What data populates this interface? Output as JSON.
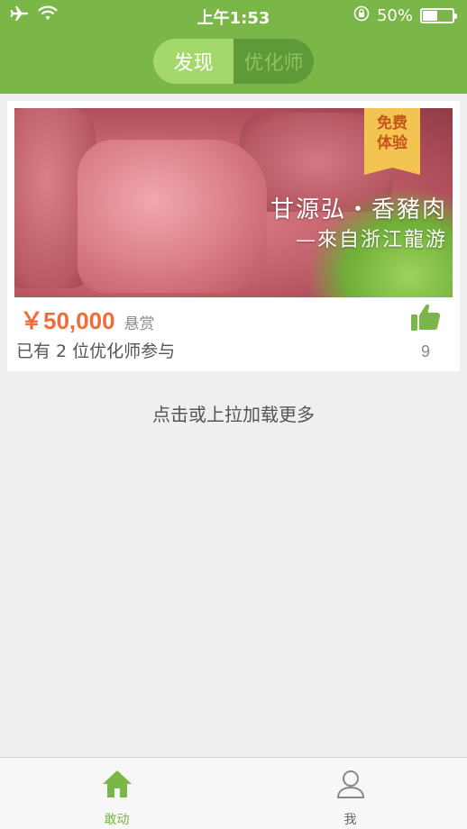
{
  "status_bar": {
    "time": "上午1:53",
    "battery_percent": "50%",
    "battery_level": 0.5
  },
  "nav": {
    "segments": [
      {
        "label": "发现",
        "selected": true
      },
      {
        "label": "优化师",
        "selected": false
      }
    ]
  },
  "card": {
    "ribbon_line1": "免费",
    "ribbon_line2": "体验",
    "banner_title": "甘源弘・香豬肉",
    "banner_subtitle": "—來自浙江龍游",
    "price": "￥50,000",
    "reward_label": "悬赏",
    "participants_text": "已有 2 位优化师参与",
    "like_count": "9"
  },
  "load_more": "点击或上拉加载更多",
  "tabbar": {
    "items": [
      {
        "label": "敢动",
        "active": true
      },
      {
        "label": "我",
        "active": false
      }
    ]
  },
  "colors": {
    "accent": "#7ab648",
    "price": "#f26c3b",
    "ribbon": "#f3c451"
  }
}
